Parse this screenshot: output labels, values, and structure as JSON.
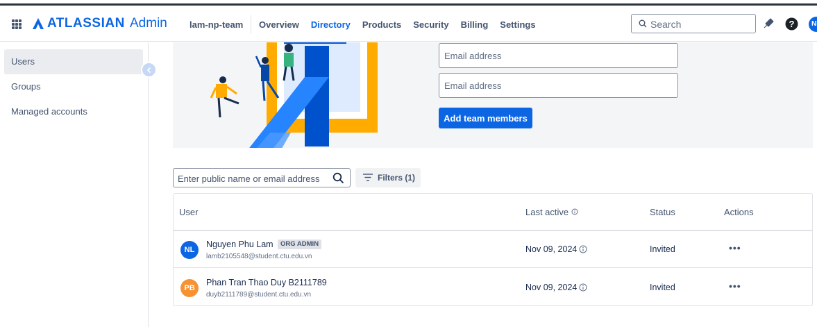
{
  "header": {
    "brand": "ATLASSIAN",
    "brand_sub": "Admin",
    "org_name": "lam-np-team",
    "nav": [
      "Overview",
      "Directory",
      "Products",
      "Security",
      "Billing",
      "Settings"
    ],
    "active_nav": "Directory",
    "search_placeholder": "Search",
    "avatar_initials": "NL",
    "accent_color": "#0c66e4"
  },
  "sidebar": {
    "items": [
      {
        "label": "Users",
        "active": true
      },
      {
        "label": "Groups",
        "active": false
      },
      {
        "label": "Managed accounts",
        "active": false
      }
    ]
  },
  "invite": {
    "email_placeholder_1": "Email address",
    "email_placeholder_2": "Email address",
    "add_button": "Add team members"
  },
  "filters": {
    "search_placeholder": "Enter public name or email address",
    "filters_label": "Filters (1)"
  },
  "table": {
    "headers": {
      "user": "User",
      "last_active": "Last active",
      "status": "Status",
      "actions": "Actions"
    },
    "rows": [
      {
        "initials": "NL",
        "avatar_color": "#0c66e4",
        "name": "Nguyen Phu Lam",
        "badge": "ORG ADMIN",
        "email": "lamb2105548@student.ctu.edu.vn",
        "last_active": "Nov 09, 2024",
        "status": "Invited",
        "actions": "•••"
      },
      {
        "initials": "PB",
        "avatar_color": "#f79232",
        "name": "Phan Tran Thao Duy B2111789",
        "badge": "",
        "email": "duyb2111789@student.ctu.edu.vn",
        "last_active": "Nov 09, 2024",
        "status": "Invited",
        "actions": "•••"
      }
    ]
  }
}
